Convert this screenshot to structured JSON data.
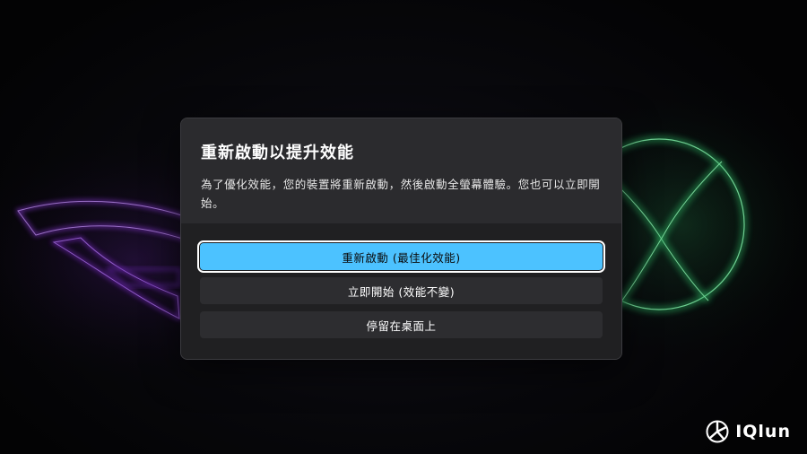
{
  "dialog": {
    "title": "重新啟動以提升效能",
    "description": "為了優化效能，您的裝置將重新啟動，然後啟動全螢幕體驗。您也可以立即開始。",
    "buttons": {
      "restart": "重新啟動 (最佳化效能)",
      "start_now": "立即開始 (效能不變)",
      "stay_desktop": "停留在桌面上"
    }
  },
  "watermark": {
    "text": "IQlun"
  },
  "colors": {
    "accent": "#4cc2ff",
    "dialog_bg": "#2b2b2e",
    "dialog_footer_bg": "#202022",
    "glow_purple": "#9a3cf0",
    "glow_green": "#39d67a"
  },
  "icons": {
    "background_left": "rog-eye-logo",
    "background_right": "xbox-logo",
    "watermark": "iqlun-logo-icon"
  }
}
